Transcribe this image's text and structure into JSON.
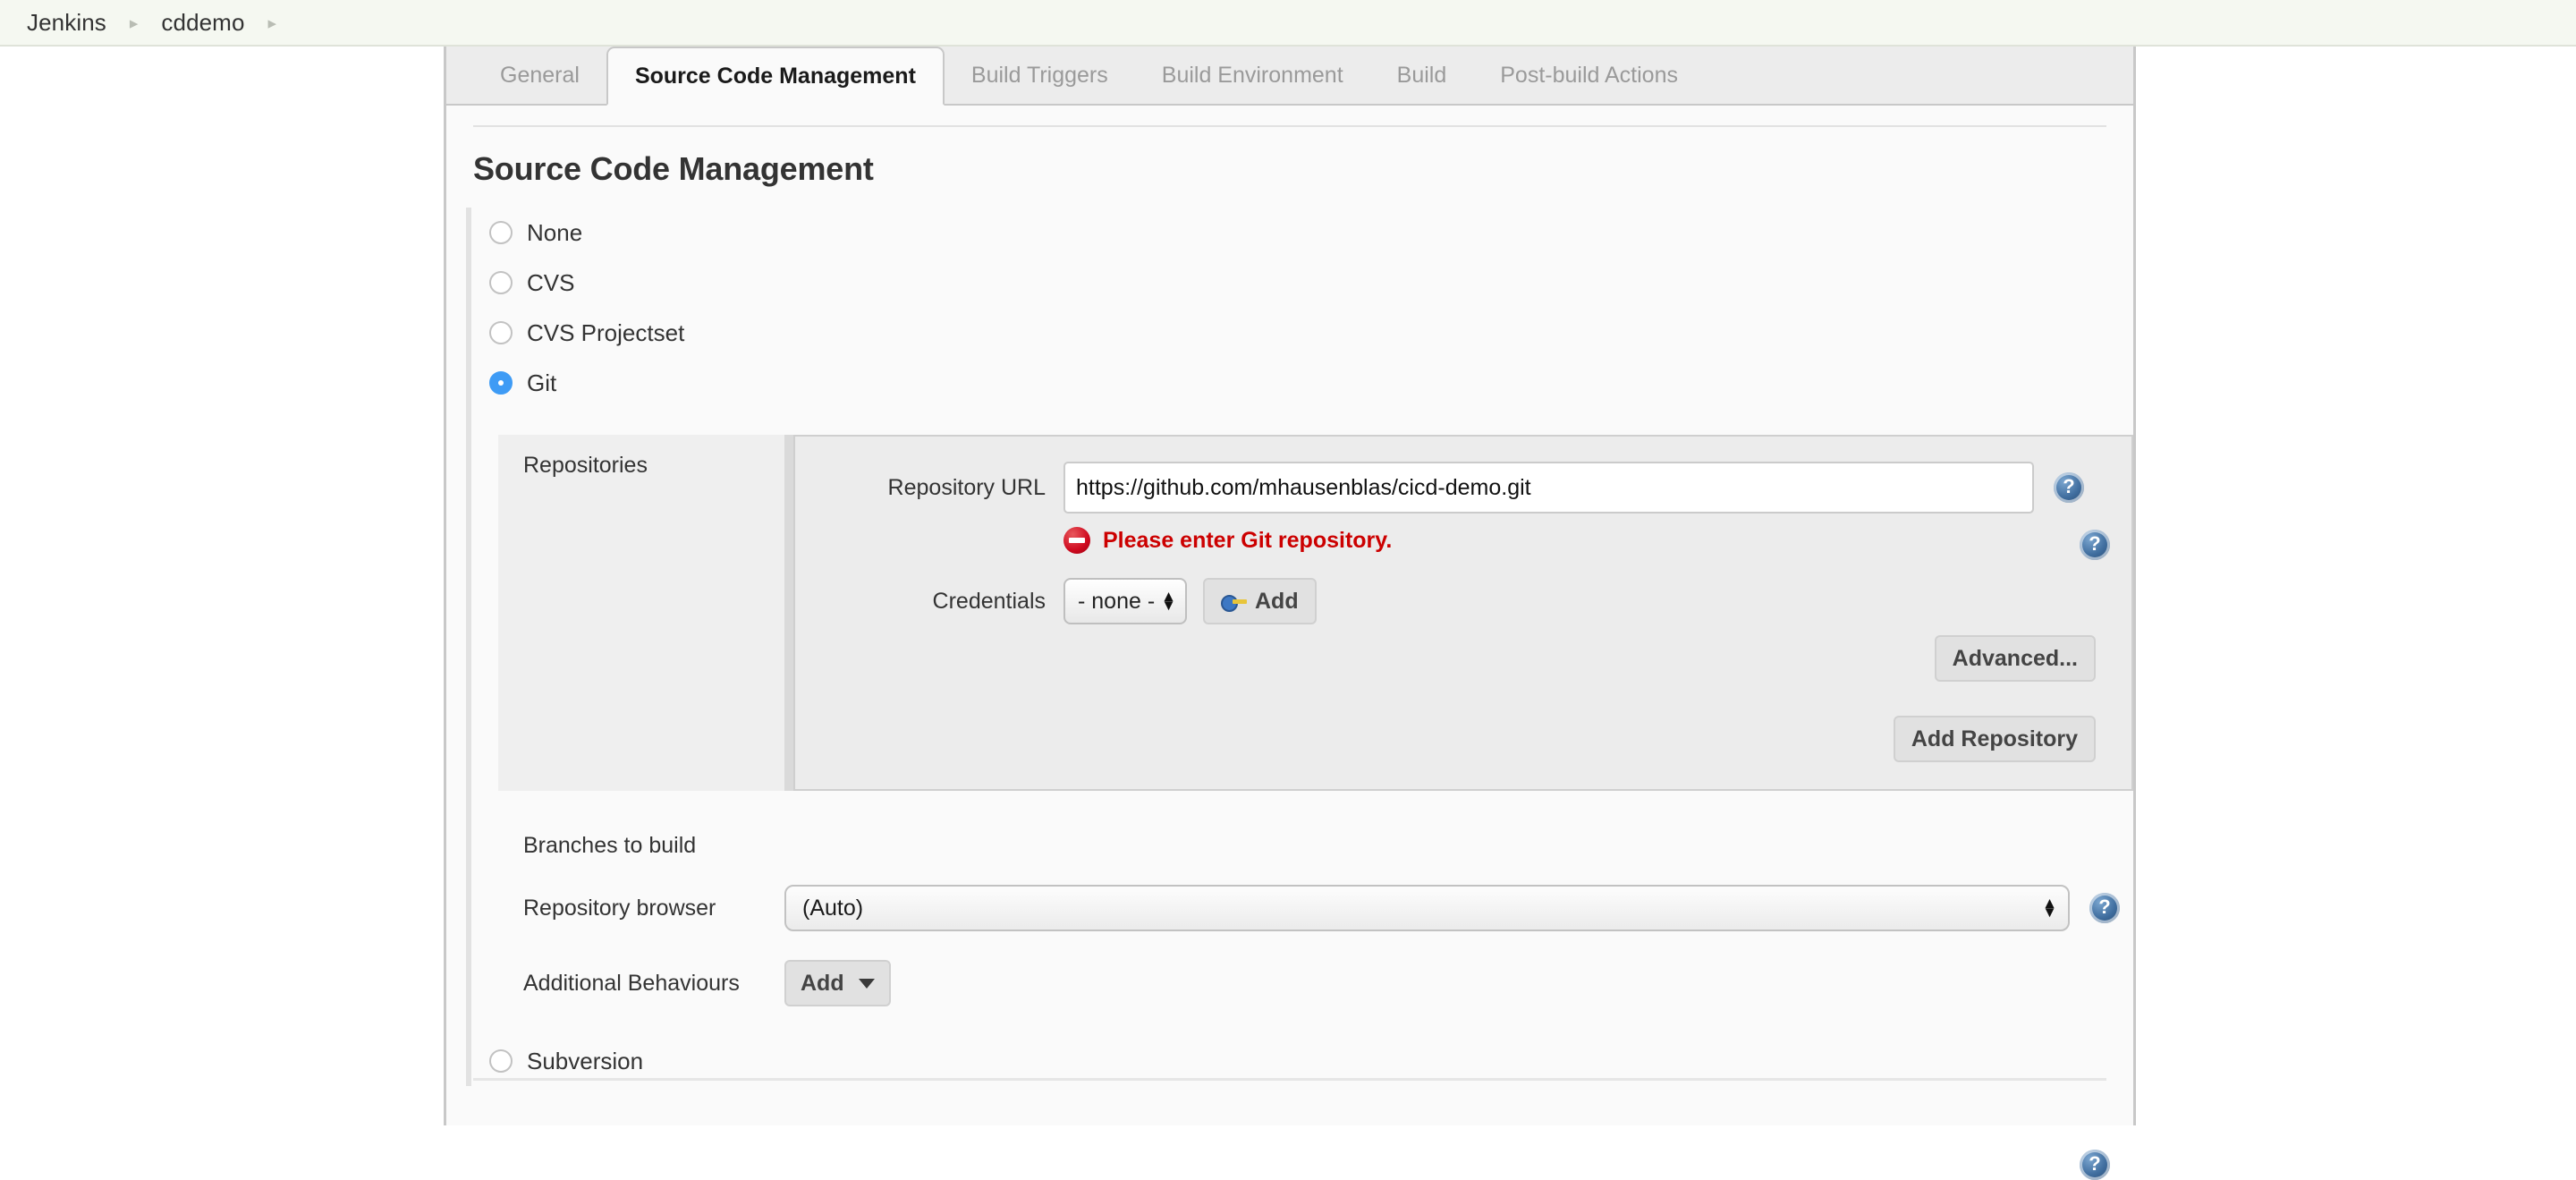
{
  "breadcrumb": {
    "items": [
      {
        "label": "Jenkins"
      },
      {
        "label": "cddemo"
      }
    ],
    "separator": "▸"
  },
  "tabs": [
    {
      "label": "General",
      "active": false
    },
    {
      "label": "Source Code Management",
      "active": true
    },
    {
      "label": "Build Triggers",
      "active": false
    },
    {
      "label": "Build Environment",
      "active": false
    },
    {
      "label": "Build",
      "active": false
    },
    {
      "label": "Post-build Actions",
      "active": false
    }
  ],
  "section": {
    "title": "Source Code Management"
  },
  "scm_options": [
    {
      "label": "None",
      "selected": false
    },
    {
      "label": "CVS",
      "selected": false
    },
    {
      "label": "CVS Projectset",
      "selected": false
    },
    {
      "label": "Git",
      "selected": true
    },
    {
      "label": "Subversion",
      "selected": false
    }
  ],
  "git": {
    "repositories_label": "Repositories",
    "repository_url": {
      "label": "Repository URL",
      "value": "https://github.com/mhausenblas/cicd-demo.git",
      "placeholder": ""
    },
    "error": {
      "text": "Please enter Git repository.",
      "icon": "error-circle-icon",
      "color": "#cc0000"
    },
    "credentials": {
      "label": "Credentials",
      "selected": "- none -",
      "add_button": "Add",
      "add_icon": "key-icon"
    },
    "advanced_button": "Advanced...",
    "add_repository_button": "Add Repository",
    "branches_label": "Branches to build",
    "repository_browser": {
      "label": "Repository browser",
      "selected": "(Auto)"
    },
    "additional_behaviours": {
      "label": "Additional Behaviours",
      "add_button": "Add"
    }
  },
  "help": {
    "glyph": "?",
    "name": "help-icon",
    "color": "#3f6d9e"
  },
  "colors": {
    "accent_radio": "#3e9bf5",
    "error": "#cc0000",
    "breadcrumb_bg": "#f5f8f1",
    "panel_bg": "#fafafa",
    "tabbar_bg": "#ececec"
  }
}
